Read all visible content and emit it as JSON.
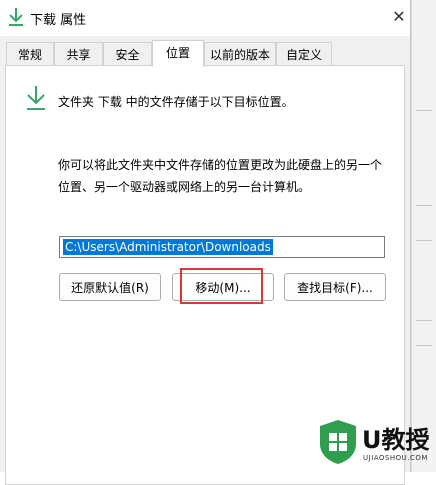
{
  "window": {
    "title": "下载 属性",
    "close_glyph": "✕"
  },
  "tabs": [
    {
      "label": "常规"
    },
    {
      "label": "共享"
    },
    {
      "label": "安全"
    },
    {
      "label": "位置",
      "active": true
    },
    {
      "label": "以前的版本"
    },
    {
      "label": "自定义"
    }
  ],
  "location": {
    "icon": "download-arrow-icon",
    "header": "文件夹 下载 中的文件存储于以下目标位置。",
    "description_line1": "你可以将此文件夹中文件存储的位置更改为此硬盘上的另一个",
    "description_line2": "位置、另一个驱动器或网络上的另一台计算机。",
    "path": "C:\\Users\\Administrator\\Downloads"
  },
  "buttons": {
    "restore_default": "还原默认值(R)",
    "move": "移动(M)...",
    "find_target": "查找目标(F)..."
  },
  "watermark": {
    "text": "U教授",
    "sub": "UJIAOSHOU.COM"
  },
  "colors": {
    "accent": "#0078d7",
    "icon_green": "#3aa56a",
    "highlight": "#e03535"
  }
}
